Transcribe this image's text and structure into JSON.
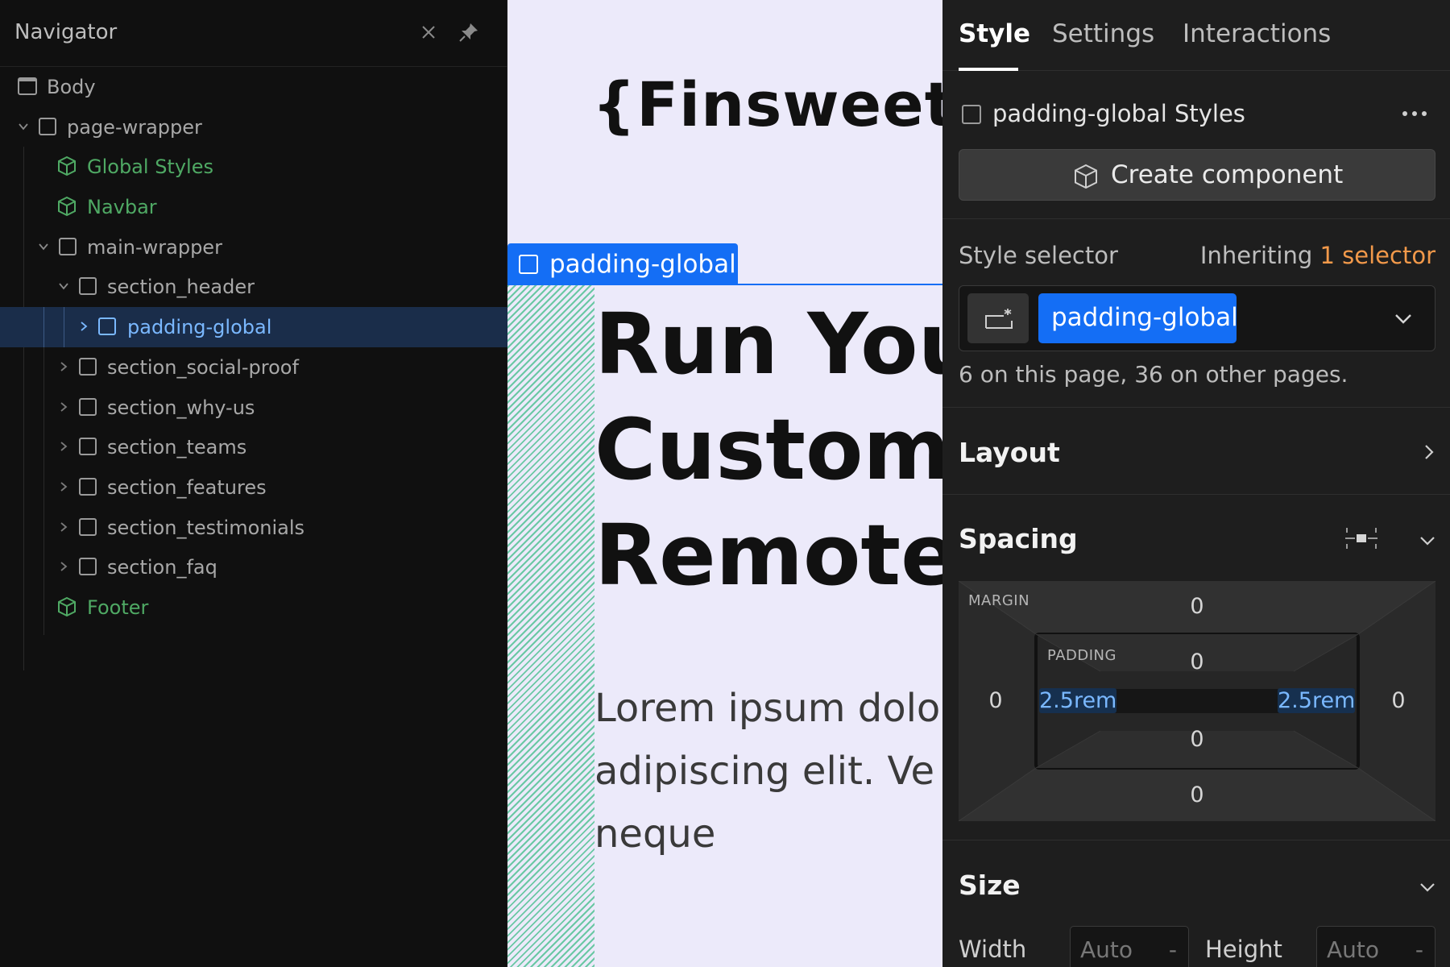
{
  "navigator": {
    "title": "Navigator",
    "items": [
      {
        "label": "Body",
        "type": "body"
      },
      {
        "label": "page-wrapper",
        "type": "element"
      },
      {
        "label": "Global Styles",
        "type": "component"
      },
      {
        "label": "Navbar",
        "type": "component"
      },
      {
        "label": "main-wrapper",
        "type": "element"
      },
      {
        "label": "section_header",
        "type": "element"
      },
      {
        "label": "padding-global",
        "type": "element",
        "selected": true
      },
      {
        "label": "section_social-proof",
        "type": "element"
      },
      {
        "label": "section_why-us",
        "type": "element"
      },
      {
        "label": "section_teams",
        "type": "element"
      },
      {
        "label": "section_features",
        "type": "element"
      },
      {
        "label": "section_testimonials",
        "type": "element"
      },
      {
        "label": "section_faq",
        "type": "element"
      },
      {
        "label": "Footer",
        "type": "component"
      }
    ]
  },
  "canvas": {
    "logo": "{Finsweet",
    "selected_tag": "padding-global",
    "hero_lines": [
      "Run You",
      "Custom",
      "Remote"
    ],
    "body_lines": [
      "Lorem ipsum dolo",
      "adipiscing elit. Ve",
      "neque"
    ]
  },
  "panel": {
    "tabs": [
      {
        "label": "Style",
        "active": true
      },
      {
        "label": "Settings",
        "active": false
      },
      {
        "label": "Interactions",
        "active": false
      }
    ],
    "class_title": "padding-global Styles",
    "create_component": "Create component",
    "style_selector_label": "Style selector",
    "inheriting_prefix": "Inheriting",
    "inheriting_count": "1 selector",
    "selector_pill": "padding-global",
    "usage": "6 on this page, 36 on other pages.",
    "layout_title": "Layout",
    "spacing": {
      "title": "Spacing",
      "margin_label": "MARGIN",
      "padding_label": "PADDING",
      "margin": {
        "top": "0",
        "right": "0",
        "bottom": "0",
        "left": "0"
      },
      "padding": {
        "top": "0",
        "right": "2.5rem",
        "bottom": "0",
        "left": "2.5rem"
      }
    },
    "size": {
      "title": "Size",
      "width_label": "Width",
      "height_label": "Height",
      "width_value": "Auto",
      "height_value": "Auto",
      "unit": "-"
    }
  },
  "colors": {
    "accent": "#146ef5",
    "component": "#4fa964",
    "inherit_highlight": "#f2994a"
  }
}
